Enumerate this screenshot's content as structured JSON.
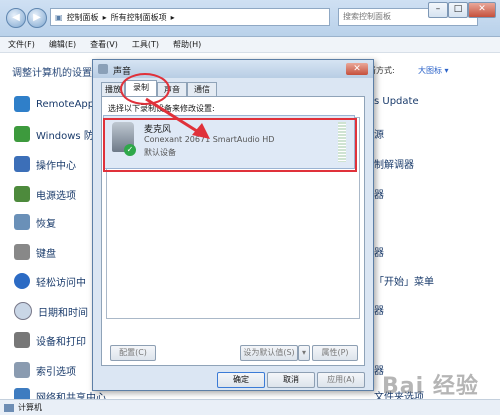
{
  "window": {
    "breadcrumb": [
      "控制面板",
      "所有控制面板项"
    ],
    "search_placeholder": "搜索控制面板"
  },
  "menu": [
    "文件(F)",
    "编辑(E)",
    "查看(V)",
    "工具(T)",
    "帮助(H)"
  ],
  "control_panel": {
    "heading": "调整计算机的设置",
    "view_label": "查看方式:",
    "view_value": "大图标 ▾",
    "left_items": [
      "RemoteApp",
      "Windows 防",
      "操作中心",
      "电源选项",
      "恢复",
      "键盘",
      "轻松访问中",
      "日期和时间",
      "设备和打印",
      "索引选项",
      "网络和共享中心"
    ],
    "right_items": [
      "s Update",
      "源",
      "制解调器",
      "器",
      "器",
      "「开始」菜单",
      "器",
      "",
      "",
      "器",
      "文件夹选项"
    ]
  },
  "statusbar": {
    "text": "计算机"
  },
  "dialog": {
    "title": "声音",
    "tabs": [
      "播放",
      "录制",
      "声音",
      "通信"
    ],
    "instruction": "选择以下录制设备来修改设置:",
    "device": {
      "name": "麦克风",
      "driver": "Conexant 20671 SmartAudio HD",
      "status": "默认设备"
    },
    "buttons": {
      "configure": "配置(C)",
      "set_default": "设为默认值(S)",
      "properties": "属性(P)",
      "ok": "确定",
      "cancel": "取消",
      "apply": "应用(A)"
    }
  },
  "watermark": "Bai 经验",
  "colors": {
    "annotation_red": "#e0313a",
    "accent_blue": "#2a62c9"
  }
}
